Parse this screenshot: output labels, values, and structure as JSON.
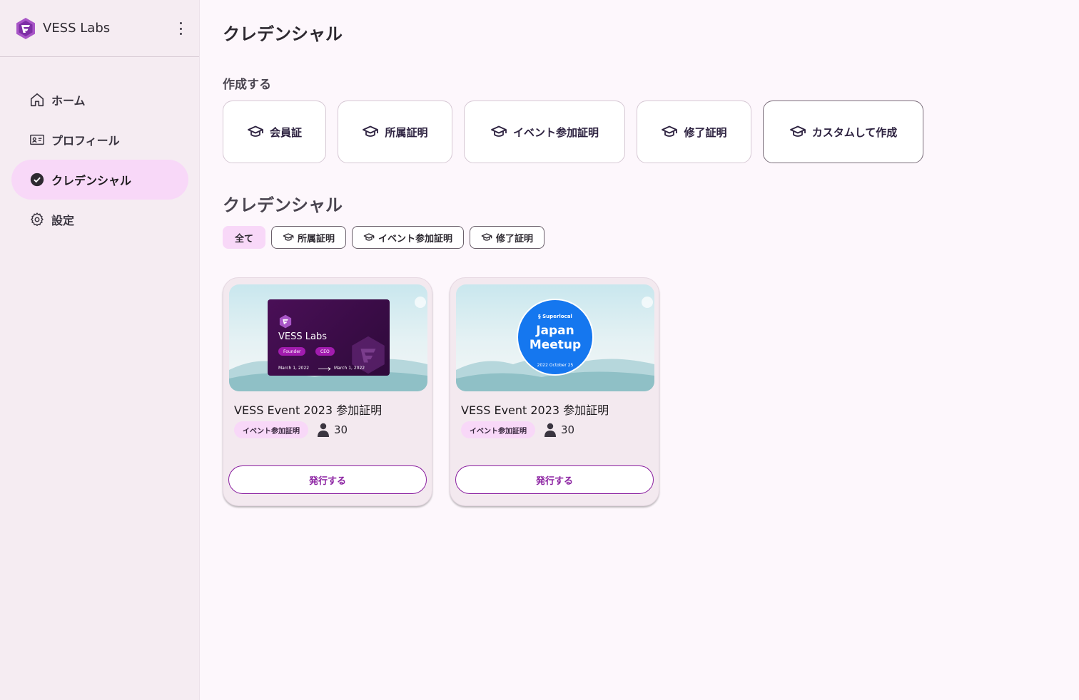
{
  "sidebar": {
    "org_name": "VESS Labs",
    "nav": [
      {
        "label": "ホーム",
        "icon": "home-icon"
      },
      {
        "label": "プロフィール",
        "icon": "id-card-icon"
      },
      {
        "label": "クレデンシャル",
        "icon": "check-circle-icon",
        "active": true
      },
      {
        "label": "設定",
        "icon": "gear-icon"
      }
    ]
  },
  "main": {
    "title": "クレデンシャル",
    "create_section_label": "作成する",
    "create_buttons": [
      {
        "label": "会員証",
        "icon": "graduation-cap-icon"
      },
      {
        "label": "所属証明",
        "icon": "graduation-cap-icon"
      },
      {
        "label": "イベント参加証明",
        "icon": "graduation-cap-icon"
      },
      {
        "label": "修了証明",
        "icon": "graduation-cap-icon"
      },
      {
        "label": "カスタムして作成",
        "icon": "graduation-cap-icon"
      }
    ],
    "credentials_section_label": "クレデンシャル",
    "filters": [
      {
        "label": "全て",
        "selected": true
      },
      {
        "label": "所属証明",
        "icon": "graduation-cap-icon"
      },
      {
        "label": "イベント参加証明",
        "icon": "graduation-cap-icon"
      },
      {
        "label": "修了証明",
        "icon": "graduation-cap-icon"
      }
    ],
    "cards": [
      {
        "title": "VESS Event 2023 参加証明",
        "badge": "イベント参加証明",
        "holders": "30",
        "action": "発行する",
        "image": {
          "org": "VESS Labs",
          "tag1": "Founder",
          "tag2": "CEO",
          "date_from": "March 1, 2022",
          "date_to": "March 1, 2022"
        }
      },
      {
        "title": "VESS Event 2023 参加証明",
        "badge": "イベント参加証明",
        "holders": "30",
        "action": "発行する",
        "image": {
          "brand": "Superlocal",
          "line1": "Japan",
          "line2": "Meetup",
          "footer": "2022  October 25"
        }
      }
    ]
  },
  "colors": {
    "accent": "#8a1fa0",
    "active_bg": "#f8d8f8",
    "sidebar_bg": "#f5ecf2",
    "page_bg": "#fdf7fc"
  }
}
